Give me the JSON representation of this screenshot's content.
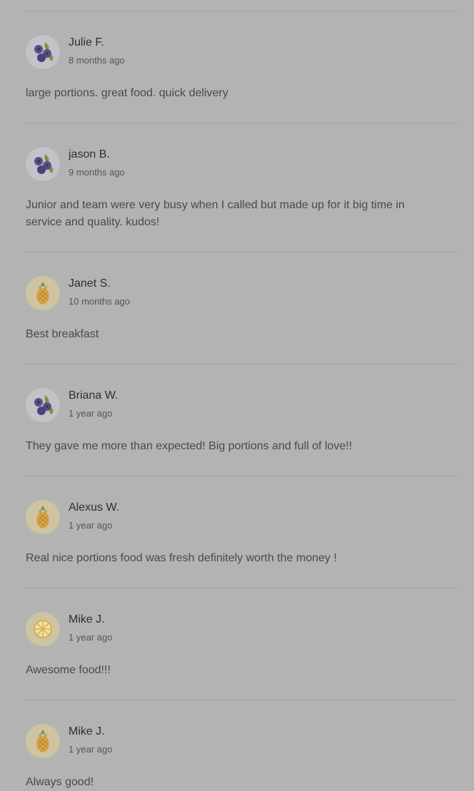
{
  "reviews": [
    {
      "name": "Julie F.",
      "time": "8 months ago",
      "text": "large portions. great food. quick delivery",
      "avatar": "blueberry-icon"
    },
    {
      "name": "jason B.",
      "time": "9 months ago",
      "text": "Junior and team were very busy when I called but made up for it big time in service and quality. kudos!",
      "avatar": "blueberry-icon"
    },
    {
      "name": "Janet S.",
      "time": "10 months ago",
      "text": "Best breakfast",
      "avatar": "pineapple-icon"
    },
    {
      "name": "Briana W.",
      "time": "1 year ago",
      "text": "They gave me more than expected! Big portions and full of love!!",
      "avatar": "blueberry-icon"
    },
    {
      "name": "Alexus W.",
      "time": "1 year ago",
      "text": "Real nice portions food was fresh definitely worth the money !",
      "avatar": "pineapple-icon"
    },
    {
      "name": "Mike J.",
      "time": "1 year ago",
      "text": "Awesome food!!!",
      "avatar": "lemon-slice-icon"
    },
    {
      "name": "Mike J.",
      "time": "1 year ago",
      "text": "Always good!",
      "avatar": "pineapple-icon"
    }
  ],
  "colors": {
    "background": "#b3b3b3",
    "divider": "#a3a3a3",
    "name": "#2f2f2f",
    "text": "#4a4a4a"
  }
}
